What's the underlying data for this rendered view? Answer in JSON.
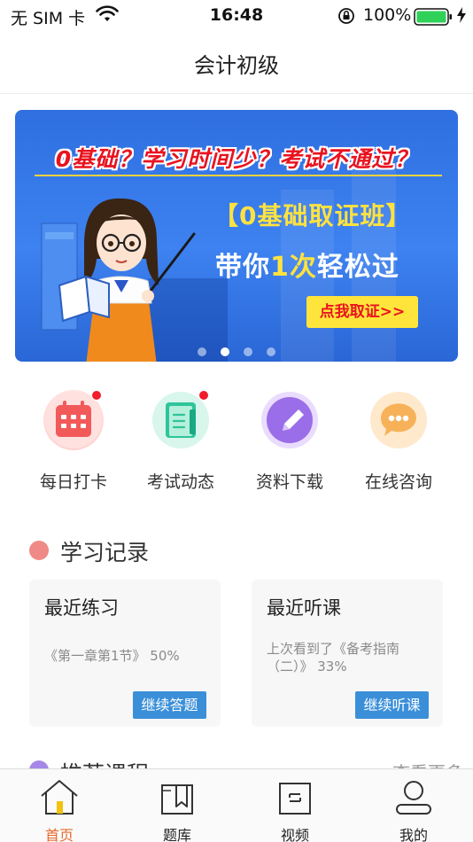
{
  "status_bar": {
    "carrier": "无 SIM 卡",
    "time": "16:48",
    "battery_percent": "100%"
  },
  "nav": {
    "title": "会计初级"
  },
  "banner": {
    "headline": "0基础？学习时间少？考试不通过？",
    "line1": "【0基础取证班】",
    "line2_pre": "带你",
    "line2_hl": "1次",
    "line2_post": "轻松过",
    "cta": "点我取证>>",
    "dots_total": 4,
    "dots_active_index": 1,
    "colors": {
      "accent_yellow": "#ffe240",
      "headline_red": "#e8131f",
      "bg_blue": "#3d82f0"
    }
  },
  "quick_actions": [
    {
      "label": "每日打卡",
      "icon": "calendar-icon",
      "has_badge": true,
      "color": "#f47070"
    },
    {
      "label": "考试动态",
      "icon": "document-icon",
      "has_badge": true,
      "color": "#2fc49a"
    },
    {
      "label": "资料下载",
      "icon": "pencil-icon",
      "has_badge": false,
      "color": "#9a6ee8"
    },
    {
      "label": "在线咨询",
      "icon": "chat-bubble-icon",
      "has_badge": false,
      "color": "#f7b259"
    }
  ],
  "study_record": {
    "title": "学习记录",
    "cards": [
      {
        "title": "最近练习",
        "detail": "《第一章第1节》 50%",
        "button": "继续答题"
      },
      {
        "title": "最近听课",
        "detail": "上次看到了《备考指南（二）》 33%",
        "button": "继续听课"
      }
    ]
  },
  "recommended": {
    "title": "推荐课程",
    "more": "查看更多"
  },
  "tabbar": {
    "tabs": [
      {
        "label": "首页",
        "icon": "home-icon",
        "active": true
      },
      {
        "label": "题库",
        "icon": "bookmark-book-icon",
        "active": false
      },
      {
        "label": "视频",
        "icon": "video-doc-icon",
        "active": false
      },
      {
        "label": "我的",
        "icon": "user-icon",
        "active": false
      }
    ],
    "active_color": "#e66a2c"
  }
}
